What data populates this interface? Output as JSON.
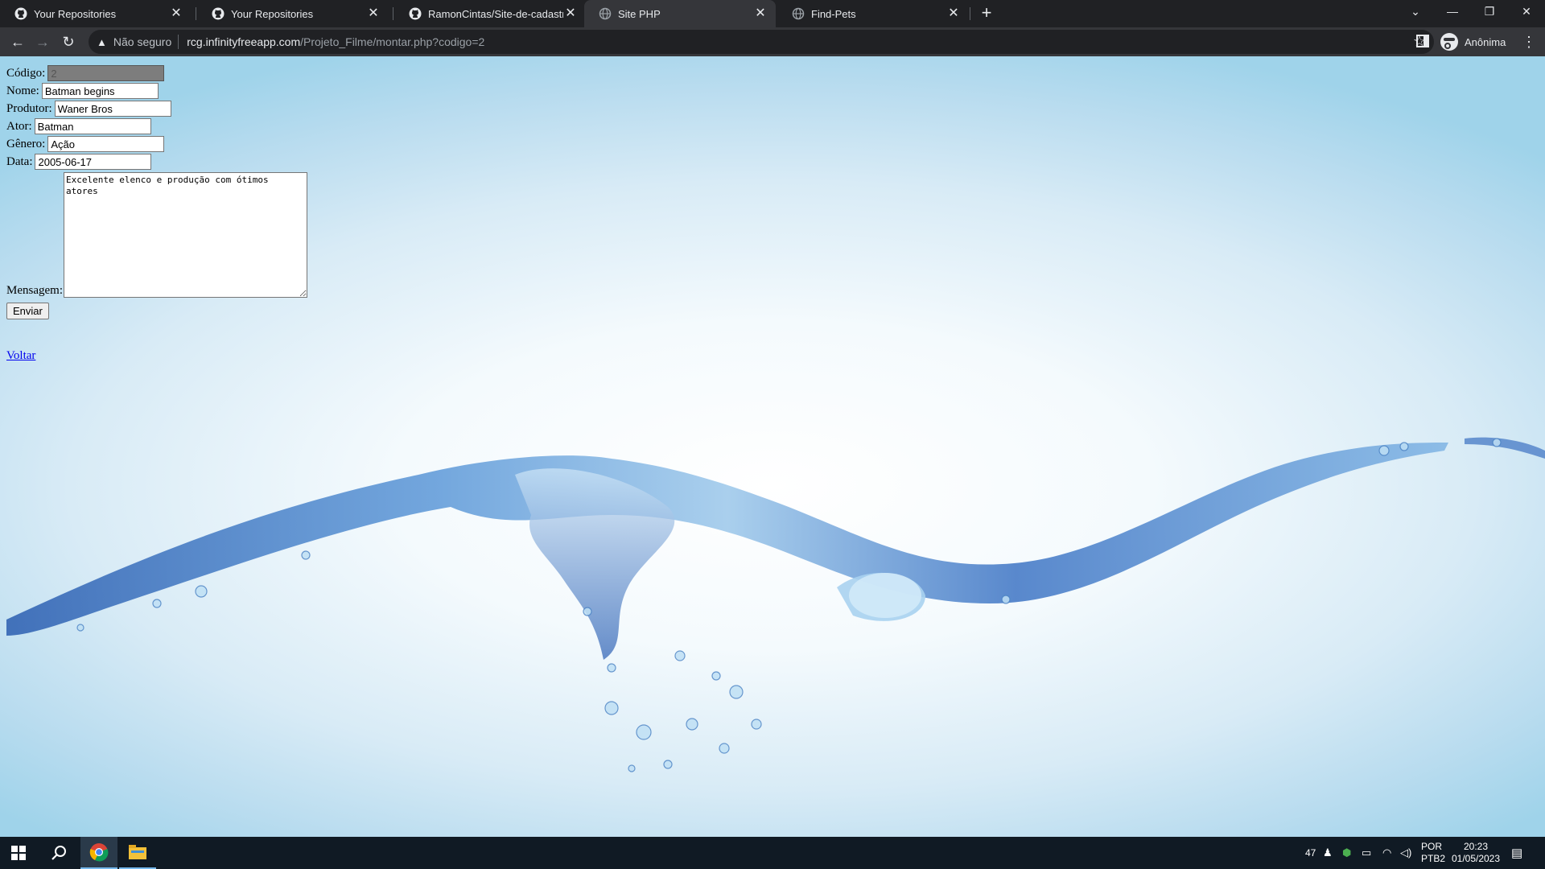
{
  "browser": {
    "tabs": [
      {
        "title": "Your Repositories",
        "icon": "github-icon",
        "active": false
      },
      {
        "title": "Your Repositories",
        "icon": "github-icon",
        "active": false
      },
      {
        "title": "RamonCintas/Site-de-cadastro-d",
        "icon": "github-icon",
        "active": false
      },
      {
        "title": "Site PHP",
        "icon": "globe-icon",
        "active": true
      },
      {
        "title": "Find-Pets",
        "icon": "globe-icon",
        "active": false
      }
    ],
    "address": {
      "security_label": "Não seguro",
      "host": "rcg.infinityfreeapp.com",
      "path": "/Projeto_Filme/montar.php?codigo=2"
    },
    "profile_label": "Anônima"
  },
  "form": {
    "codigo": {
      "label": "Código:",
      "value": "2"
    },
    "nome": {
      "label": "Nome:",
      "value": "Batman begins"
    },
    "produtor": {
      "label": "Produtor:",
      "value": "Waner Bros"
    },
    "ator": {
      "label": "Ator:",
      "value": "Batman"
    },
    "genero": {
      "label": "Gênero:",
      "value": "Ação"
    },
    "data": {
      "label": "Data:",
      "value": "2005-06-17"
    },
    "mensagem": {
      "label": "Mensagem:",
      "value": "Excelente elenco e produção com ótimos atores"
    },
    "submit_label": "Enviar"
  },
  "back_link": "Voltar",
  "taskbar": {
    "temperature": "47",
    "language_line1": "POR",
    "language_line2": "PTB2",
    "time": "20:23",
    "date": "01/05/2023"
  }
}
